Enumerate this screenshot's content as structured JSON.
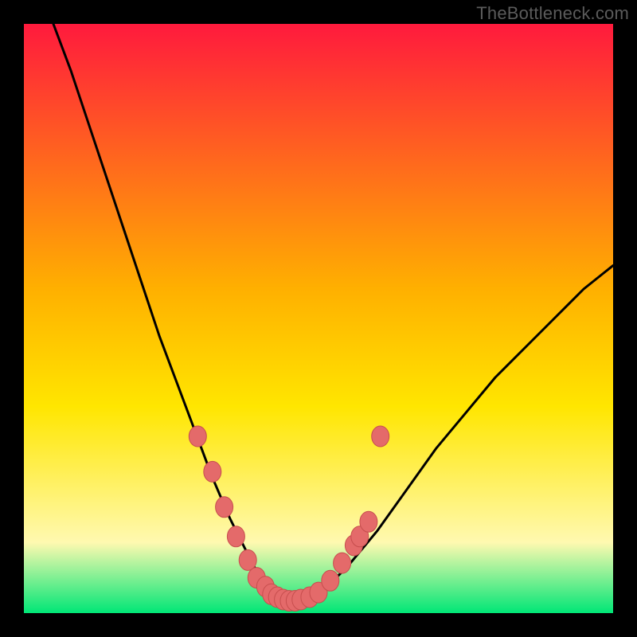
{
  "attribution": "TheBottleneck.com",
  "colors": {
    "frame": "#000000",
    "gradient_top": "#ff1a3d",
    "gradient_upper_mid": "#ffb000",
    "gradient_mid": "#ffe600",
    "gradient_lower": "#fff9b0",
    "gradient_base": "#00e676",
    "curve": "#000000",
    "marker_fill": "#e46a6a",
    "marker_stroke": "#c74e4e"
  },
  "chart_data": {
    "type": "line",
    "title": "",
    "xlabel": "",
    "ylabel": "",
    "xlim": [
      0,
      100
    ],
    "ylim": [
      0,
      100
    ],
    "series": [
      {
        "name": "bottleneck-curve",
        "x": [
          5,
          8,
          11,
          14,
          17,
          20,
          23,
          26,
          29,
          32,
          35,
          37,
          39,
          41,
          43,
          45,
          47,
          50,
          55,
          60,
          65,
          70,
          75,
          80,
          85,
          90,
          95,
          100
        ],
        "y": [
          100,
          92,
          83,
          74,
          65,
          56,
          47,
          39,
          31,
          23,
          16,
          12,
          8,
          5,
          3,
          2,
          2,
          3,
          8,
          14,
          21,
          28,
          34,
          40,
          45,
          50,
          55,
          59
        ]
      }
    ],
    "markers": {
      "name": "highlighted-points",
      "x": [
        29.5,
        32,
        34,
        36,
        38,
        39.5,
        41,
        42,
        43,
        44,
        45,
        46,
        47,
        48.5,
        50,
        52,
        54,
        56,
        57,
        58.5,
        60.5
      ],
      "y": [
        30,
        24,
        18,
        13,
        9,
        6,
        4.5,
        3.2,
        2.7,
        2.3,
        2.1,
        2.1,
        2.3,
        2.7,
        3.5,
        5.5,
        8.5,
        11.5,
        13,
        15.5,
        30
      ]
    }
  }
}
